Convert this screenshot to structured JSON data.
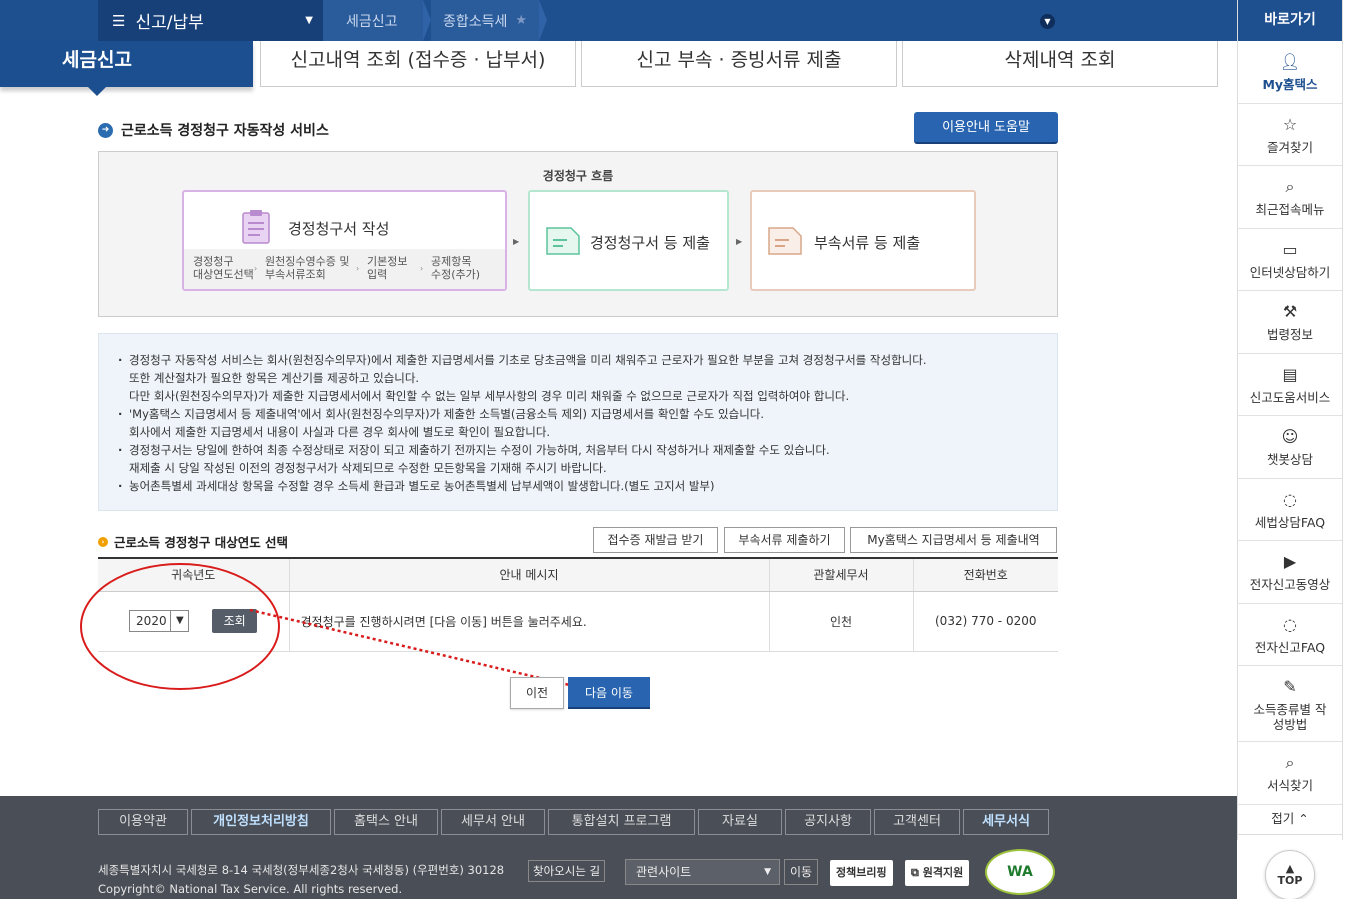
{
  "topbar": {
    "menu_label": "신고/납부",
    "crumbs": [
      "세금신고",
      "종합소득세"
    ]
  },
  "tabs": {
    "active": "세금신고",
    "items": [
      "신고내역 조회 (접수증 · 납부서)",
      "신고 부속 · 증빙서류 제출",
      "삭제내역 조회"
    ]
  },
  "section": {
    "title": "근로소득 경정청구 자동작성 서비스",
    "help_button": "이용안내 도움말"
  },
  "flow": {
    "title": "경정청구 흐름",
    "step1_title": "경정청구서 작성",
    "step1_sub": [
      {
        "l1": "경정청구",
        "l2": "대상연도선택"
      },
      {
        "l1": "원천징수영수증 및",
        "l2": "부속서류조회"
      },
      {
        "l1": "기본정보",
        "l2": "입력"
      },
      {
        "l1": "공제항목",
        "l2": "수정(추가)"
      }
    ],
    "step2_title": "경정청구서 등 제출",
    "step3_title": "부속서류 등 제출"
  },
  "notice": {
    "lines": [
      {
        "bullet": true,
        "text": "경정청구 자동작성 서비스는 회사(원천징수의무자)에서 제출한 지급명세서를 기초로 당초금액을 미리 채워주고 근로자가 필요한 부분을 고쳐 경정청구서를 작성합니다."
      },
      {
        "bullet": false,
        "text": "또한 계산절차가 필요한 항목은 계산기를 제공하고 있습니다."
      },
      {
        "bullet": false,
        "text": "다만 회사(원천징수의무자)가 제출한 지급명세서에서 확인할 수 없는 일부 세부사항의 경우 미리 채워줄 수 없으므로 근로자가 직접 입력하여야 합니다."
      },
      {
        "bullet": true,
        "text": "'My홈택스 지급명세서 등 제출내역'에서 회사(원천징수의무자)가 제출한 소득별(금융소득 제외) 지급명세서를 확인할 수도 있습니다."
      },
      {
        "bullet": false,
        "text": "회사에서 제출한 지급명세서 내용이 사실과 다른 경우 회사에 별도로 확인이 필요합니다."
      },
      {
        "bullet": true,
        "text": "경정청구서는 당일에 한하여 최종 수정상태로 저장이 되고 제출하기 전까지는 수정이 가능하며, 처음부터 다시 작성하거나 재제출할 수도 있습니다."
      },
      {
        "bullet": false,
        "text": "재제출 시 당일 작성된 이전의 경정청구서가 삭제되므로 수정한 모든항목을 기재해 주시기 바랍니다."
      },
      {
        "bullet": true,
        "text": "농어촌특별세 과세대상 항목을 수정할 경우 소득세 환급과 별도로 농어촌특별세 납부세액이 발생합니다.(별도 고지서 발부)"
      }
    ]
  },
  "select_section": {
    "title": "근로소득 경정청구 대상연도 선택",
    "buttons": [
      "접수증 재발급 받기",
      "부속서류 제출하기",
      "My홈택스 지급명세서 등 제출내역"
    ]
  },
  "table": {
    "headers": [
      "귀속년도",
      "안내 메시지",
      "관할세무서",
      "전화번호"
    ],
    "year_value": "2020",
    "query_button": "조회",
    "message": "경정청구를 진행하시려면 [다음 이동] 버튼을 눌러주세요.",
    "office": "인천",
    "phone": "(032) 770 - 0200"
  },
  "actions": {
    "prev": "이전",
    "next": "다음 이동"
  },
  "footer": {
    "links": [
      "이용약관",
      "개인정보처리방침",
      "홈택스 안내",
      "세무서 안내",
      "통합설치 프로그램",
      "자료실",
      "공지사항",
      "고객센터",
      "세무서식"
    ],
    "address": "세종특별자치시 국세청로 8-14 국세청(정부세종2청사 국세청동) (우편번호) 30128",
    "findway": "찾아오시는 길",
    "related_select": "관련사이트",
    "go": "이동",
    "badge1": "정책브리핑",
    "badge2": "원격지원",
    "copyright": "Copyright© National Tax Service. All rights reserved.",
    "wa_text": "WA"
  },
  "sidebar": {
    "title": "바로가기",
    "items": [
      {
        "label": "My홈택스",
        "icon": "person-icon"
      },
      {
        "label": "즐겨찾기",
        "icon": "star-icon"
      },
      {
        "label": "최근접속메뉴",
        "icon": "recent-icon"
      },
      {
        "label": "인터넷상담하기",
        "icon": "monitor-icon"
      },
      {
        "label": "법령정보",
        "icon": "gavel-icon"
      },
      {
        "label": "신고도움서비스",
        "icon": "book-icon"
      },
      {
        "label": "챗봇상담",
        "icon": "chatbot-icon"
      },
      {
        "label": "세법상담FAQ",
        "icon": "chat-icon"
      },
      {
        "label": "전자신고동영상",
        "icon": "play-icon"
      },
      {
        "label": "전자신고FAQ",
        "icon": "chat-icon"
      },
      {
        "label": "소득종류별 작성방법",
        "icon": "edit-icon"
      },
      {
        "label": "서식찾기",
        "icon": "search-icon"
      }
    ],
    "close": "접기",
    "top": "TOP"
  }
}
